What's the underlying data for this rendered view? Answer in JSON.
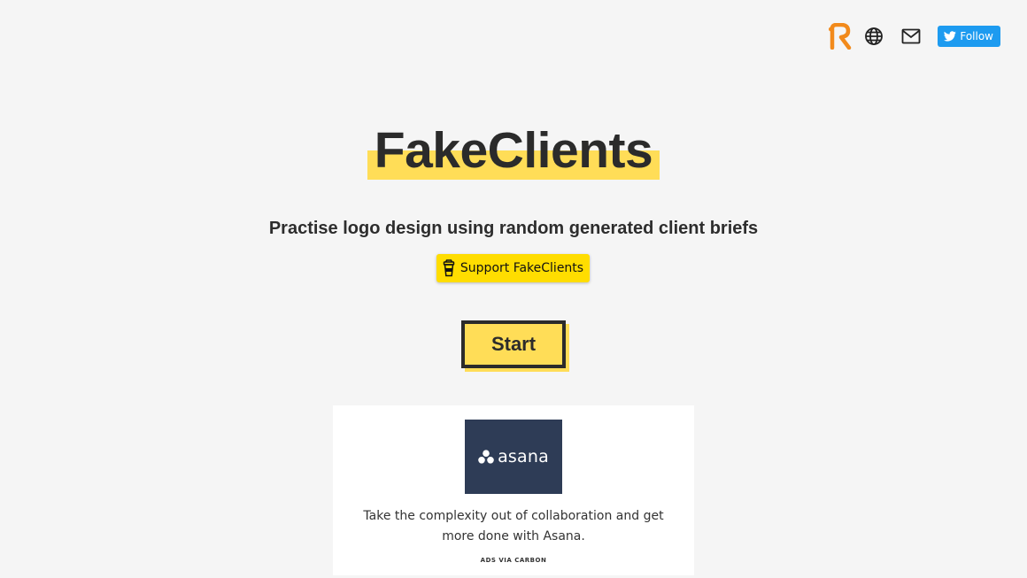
{
  "nav": {
    "r_logo_icon": "r-logo-icon",
    "globe_icon": "globe-icon",
    "mail_icon": "mail-icon",
    "follow_label": "Follow",
    "follow_icon": "twitter-bird-icon"
  },
  "hero": {
    "title": "FakeClients",
    "subtitle": "Practise logo design using random generated client briefs"
  },
  "support_button": {
    "label": "Support FakeClients",
    "icon": "coffee-cup-icon"
  },
  "start_button": {
    "label": "Start"
  },
  "ad": {
    "brand_name": "asana",
    "text": "Take the complexity out of collaboration and get more done with Asana.",
    "via": "ADS VIA CARBON"
  },
  "colors": {
    "background": "#f5f5f5",
    "highlight": "#ffdd57",
    "support_yellow": "#ffdd00",
    "twitter_blue": "#1d9bf0",
    "ad_navy": "#2e3c56",
    "r_logo_orange": "#f28a1b"
  }
}
